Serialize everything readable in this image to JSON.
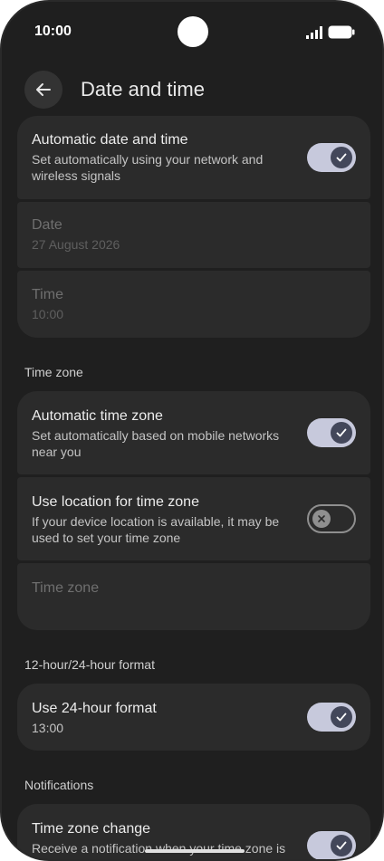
{
  "status_bar": {
    "time": "10:00"
  },
  "header": {
    "title": "Date and time"
  },
  "datetime": {
    "automatic": {
      "title": "Automatic date and time",
      "subtitle": "Set automatically using your network and wireless signals",
      "enabled": true
    },
    "date": {
      "title": "Date",
      "value": "27 August 2026"
    },
    "time": {
      "title": "Time",
      "value": "10:00"
    }
  },
  "time_zone": {
    "header": "Time zone",
    "automatic": {
      "title": "Automatic time zone",
      "subtitle": "Set automatically based on mobile networks near you",
      "enabled": true
    },
    "use_location": {
      "title": "Use location for time zone",
      "subtitle": "If your device location is available, it may be used to set your time zone",
      "enabled": false
    },
    "zone": {
      "title": "Time zone"
    }
  },
  "format": {
    "header": "12-hour/24-hour format",
    "use_24h": {
      "title": "Use 24-hour format",
      "value": "13:00",
      "enabled": true
    }
  },
  "notifications": {
    "header": "Notifications",
    "tz_change": {
      "title": "Time zone change",
      "subtitle": "Receive a notification when your time zone is automatically updated",
      "enabled": true
    }
  }
}
